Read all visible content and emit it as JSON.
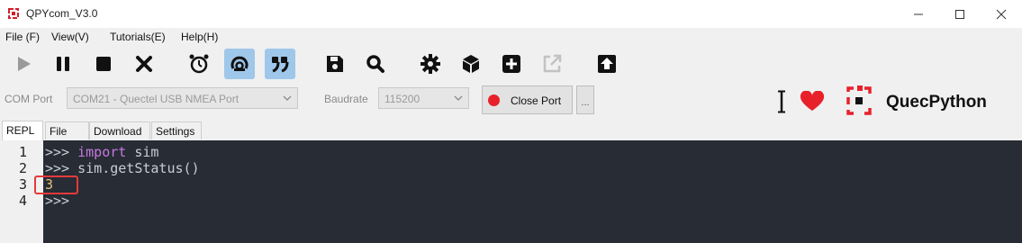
{
  "window": {
    "title": "QPYcom_V3.0",
    "controls": [
      "minimize",
      "maximize",
      "close"
    ]
  },
  "menu": {
    "items": [
      "File (F)",
      "View(V)",
      "Tutorials(E)",
      "Help(H)"
    ]
  },
  "toolbar": {
    "buttons": [
      {
        "icon": "play-icon",
        "active": false
      },
      {
        "icon": "pause-icon",
        "active": false
      },
      {
        "icon": "stop-icon",
        "active": false
      },
      {
        "icon": "close-x-icon",
        "active": false
      },
      {
        "icon": "alarm-clock-icon",
        "active": false
      },
      {
        "icon": "reset-icon",
        "active": true
      },
      {
        "icon": "quote-icon",
        "active": true
      },
      {
        "icon": "save-icon",
        "active": false
      },
      {
        "icon": "search-icon",
        "active": false
      },
      {
        "icon": "gear-icon",
        "active": false
      },
      {
        "icon": "cube-icon",
        "active": false
      },
      {
        "icon": "plus-icon",
        "active": false
      },
      {
        "icon": "external-link-icon",
        "active": false
      },
      {
        "icon": "upload-icon",
        "active": false
      }
    ]
  },
  "port": {
    "com_label": "COM Port",
    "com_value": "COM21 - Quectel USB NMEA Port",
    "baud_label": "Baudrate",
    "baud_value": "115200",
    "close_button": "Close Port",
    "more_button": "..."
  },
  "brand": {
    "name": "QuecPython",
    "accent": "#e8202a"
  },
  "tabs": [
    "REPL",
    "File",
    "Download",
    "Settings"
  ],
  "repl": {
    "line_numbers": [
      "1",
      "2",
      "3",
      "4"
    ],
    "line1_prompt": ">>> ",
    "line1_kw": "import",
    "line1_rest": " sim",
    "line2": ">>> sim.getStatus()",
    "line3": "3",
    "line4": ">>>"
  }
}
